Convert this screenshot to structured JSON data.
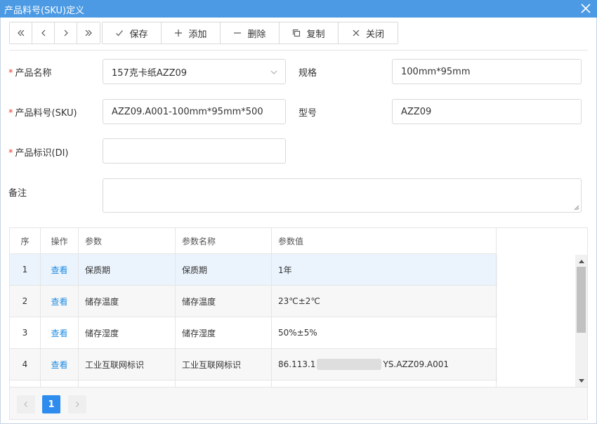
{
  "window": {
    "title": "产品料号(SKU)定义"
  },
  "toolbar": {
    "nav": [
      {
        "name": "first-page-button",
        "icon": "double-left-icon"
      },
      {
        "name": "prev-button",
        "icon": "chevron-left-icon"
      },
      {
        "name": "next-button",
        "icon": "chevron-right-icon"
      },
      {
        "name": "last-page-button",
        "icon": "double-right-icon"
      }
    ],
    "save_label": "保存",
    "add_label": "添加",
    "delete_label": "删除",
    "copy_label": "复制",
    "close_label": "关闭"
  },
  "form": {
    "required_mark": "*",
    "product_name_label": "产品名称",
    "product_name_value": "157克卡纸AZZ09",
    "spec_label": "规格",
    "spec_value": "100mm*95mm",
    "sku_label": "产品料号(SKU)",
    "sku_value": "AZZ09.A001-100mm*95mm*500",
    "model_label": "型号",
    "model_value": "AZZ09",
    "di_label": "产品标识(DI)",
    "di_value": "",
    "remark_label": "备注",
    "remark_value": ""
  },
  "grid": {
    "columns": [
      "序",
      "操作",
      "参数",
      "参数名称",
      "参数值"
    ],
    "rows": [
      {
        "no": "1",
        "action": "查看",
        "param": "保质期",
        "param_name": "保质期",
        "value": "1年"
      },
      {
        "no": "2",
        "action": "查看",
        "param": "储存温度",
        "param_name": "储存温度",
        "value": "23℃±2℃"
      },
      {
        "no": "3",
        "action": "查看",
        "param": "储存湿度",
        "param_name": "储存湿度",
        "value": "50%±5%"
      },
      {
        "no": "4",
        "action": "查看",
        "param": "工业互联网标识",
        "param_name": "工业互联网标识",
        "value_prefix": "86.113.1",
        "value_suffix": "YS.AZZ09.A001"
      }
    ]
  },
  "pager": {
    "current_page": "1"
  },
  "colors": {
    "titlebar": "#4b9ae3",
    "accent": "#2d8ced",
    "link": "#1f8ce3",
    "required": "#e3403a"
  }
}
